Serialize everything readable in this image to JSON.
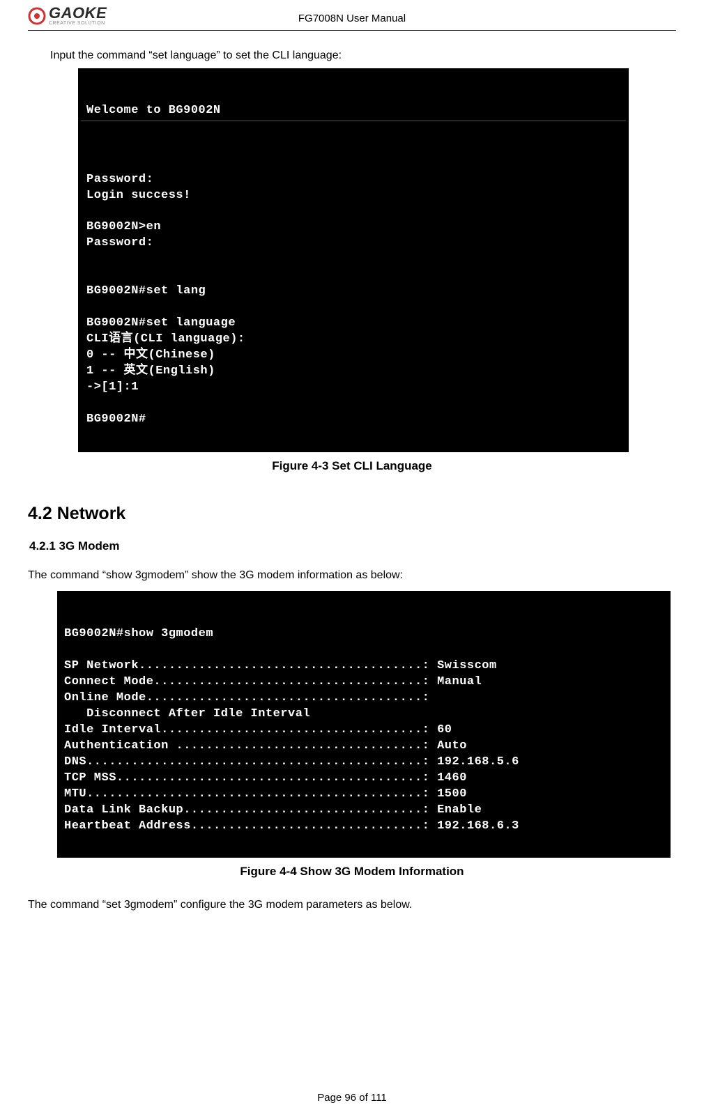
{
  "header": {
    "logo_main": "GAOKE",
    "logo_sub": "CREATIVE SOLUTION",
    "doc_title": "FG7008N User Manual"
  },
  "intro_text": "Input the command “set language” to set the CLI language:",
  "terminal1": {
    "title": "Welcome to BG9002N",
    "lines": [
      "",
      "Password:",
      "Login success!",
      "",
      "BG9002N>en",
      "Password:",
      "",
      "",
      "BG9002N#set lang",
      "",
      "BG9002N#set language",
      "CLI语言(CLI language):",
      "0 -- 中文(Chinese)",
      "1 -- 英文(English)",
      "->[1]:1",
      "",
      "BG9002N#",
      ""
    ]
  },
  "figure1_caption": "Figure 4-3    Set CLI Language",
  "h2": "4.2  Network",
  "h3": "4.2.1    3G Modem",
  "network_intro": "The command “show 3gmodem” show the 3G modem information as below:",
  "terminal2": {
    "lines": [
      "BG9002N#show 3gmodem",
      "",
      "SP Network......................................: Swisscom",
      "Connect Mode....................................: Manual",
      "Online Mode.....................................:",
      "   Disconnect After Idle Interval",
      "Idle Interval...................................: 60",
      "Authentication .................................: Auto",
      "DNS.............................................: 192.168.5.6",
      "TCP MSS.........................................: 1460",
      "MTU.............................................: 1500",
      "Data Link Backup................................: Enable",
      "Heartbeat Address...............................: 192.168.6.3"
    ]
  },
  "figure2_caption": "Figure 4-4    Show 3G Modem Information",
  "post_text": "The command “set 3gmodem” configure the 3G modem parameters as below.",
  "footer": "Page 96 of 111"
}
